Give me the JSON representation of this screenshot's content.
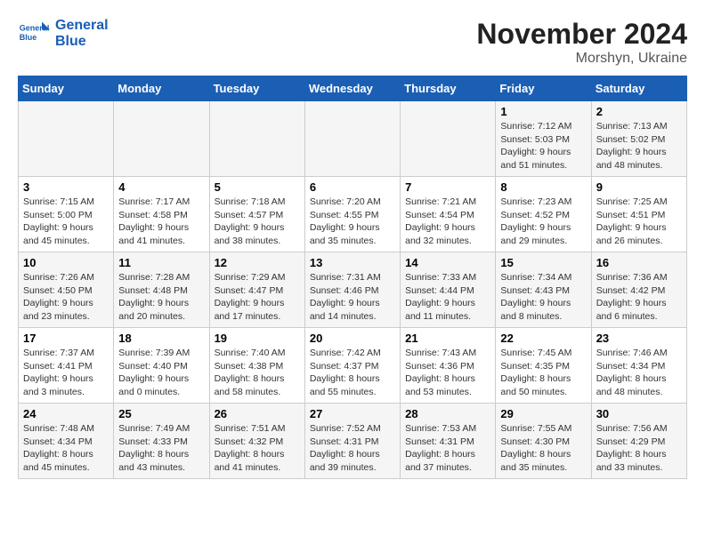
{
  "logo": {
    "line1": "General",
    "line2": "Blue"
  },
  "title": "November 2024",
  "location": "Morshyn, Ukraine",
  "days_of_week": [
    "Sunday",
    "Monday",
    "Tuesday",
    "Wednesday",
    "Thursday",
    "Friday",
    "Saturday"
  ],
  "weeks": [
    [
      {
        "day": "",
        "info": ""
      },
      {
        "day": "",
        "info": ""
      },
      {
        "day": "",
        "info": ""
      },
      {
        "day": "",
        "info": ""
      },
      {
        "day": "",
        "info": ""
      },
      {
        "day": "1",
        "info": "Sunrise: 7:12 AM\nSunset: 5:03 PM\nDaylight: 9 hours and 51 minutes."
      },
      {
        "day": "2",
        "info": "Sunrise: 7:13 AM\nSunset: 5:02 PM\nDaylight: 9 hours and 48 minutes."
      }
    ],
    [
      {
        "day": "3",
        "info": "Sunrise: 7:15 AM\nSunset: 5:00 PM\nDaylight: 9 hours and 45 minutes."
      },
      {
        "day": "4",
        "info": "Sunrise: 7:17 AM\nSunset: 4:58 PM\nDaylight: 9 hours and 41 minutes."
      },
      {
        "day": "5",
        "info": "Sunrise: 7:18 AM\nSunset: 4:57 PM\nDaylight: 9 hours and 38 minutes."
      },
      {
        "day": "6",
        "info": "Sunrise: 7:20 AM\nSunset: 4:55 PM\nDaylight: 9 hours and 35 minutes."
      },
      {
        "day": "7",
        "info": "Sunrise: 7:21 AM\nSunset: 4:54 PM\nDaylight: 9 hours and 32 minutes."
      },
      {
        "day": "8",
        "info": "Sunrise: 7:23 AM\nSunset: 4:52 PM\nDaylight: 9 hours and 29 minutes."
      },
      {
        "day": "9",
        "info": "Sunrise: 7:25 AM\nSunset: 4:51 PM\nDaylight: 9 hours and 26 minutes."
      }
    ],
    [
      {
        "day": "10",
        "info": "Sunrise: 7:26 AM\nSunset: 4:50 PM\nDaylight: 9 hours and 23 minutes."
      },
      {
        "day": "11",
        "info": "Sunrise: 7:28 AM\nSunset: 4:48 PM\nDaylight: 9 hours and 20 minutes."
      },
      {
        "day": "12",
        "info": "Sunrise: 7:29 AM\nSunset: 4:47 PM\nDaylight: 9 hours and 17 minutes."
      },
      {
        "day": "13",
        "info": "Sunrise: 7:31 AM\nSunset: 4:46 PM\nDaylight: 9 hours and 14 minutes."
      },
      {
        "day": "14",
        "info": "Sunrise: 7:33 AM\nSunset: 4:44 PM\nDaylight: 9 hours and 11 minutes."
      },
      {
        "day": "15",
        "info": "Sunrise: 7:34 AM\nSunset: 4:43 PM\nDaylight: 9 hours and 8 minutes."
      },
      {
        "day": "16",
        "info": "Sunrise: 7:36 AM\nSunset: 4:42 PM\nDaylight: 9 hours and 6 minutes."
      }
    ],
    [
      {
        "day": "17",
        "info": "Sunrise: 7:37 AM\nSunset: 4:41 PM\nDaylight: 9 hours and 3 minutes."
      },
      {
        "day": "18",
        "info": "Sunrise: 7:39 AM\nSunset: 4:40 PM\nDaylight: 9 hours and 0 minutes."
      },
      {
        "day": "19",
        "info": "Sunrise: 7:40 AM\nSunset: 4:38 PM\nDaylight: 8 hours and 58 minutes."
      },
      {
        "day": "20",
        "info": "Sunrise: 7:42 AM\nSunset: 4:37 PM\nDaylight: 8 hours and 55 minutes."
      },
      {
        "day": "21",
        "info": "Sunrise: 7:43 AM\nSunset: 4:36 PM\nDaylight: 8 hours and 53 minutes."
      },
      {
        "day": "22",
        "info": "Sunrise: 7:45 AM\nSunset: 4:35 PM\nDaylight: 8 hours and 50 minutes."
      },
      {
        "day": "23",
        "info": "Sunrise: 7:46 AM\nSunset: 4:34 PM\nDaylight: 8 hours and 48 minutes."
      }
    ],
    [
      {
        "day": "24",
        "info": "Sunrise: 7:48 AM\nSunset: 4:34 PM\nDaylight: 8 hours and 45 minutes."
      },
      {
        "day": "25",
        "info": "Sunrise: 7:49 AM\nSunset: 4:33 PM\nDaylight: 8 hours and 43 minutes."
      },
      {
        "day": "26",
        "info": "Sunrise: 7:51 AM\nSunset: 4:32 PM\nDaylight: 8 hours and 41 minutes."
      },
      {
        "day": "27",
        "info": "Sunrise: 7:52 AM\nSunset: 4:31 PM\nDaylight: 8 hours and 39 minutes."
      },
      {
        "day": "28",
        "info": "Sunrise: 7:53 AM\nSunset: 4:31 PM\nDaylight: 8 hours and 37 minutes."
      },
      {
        "day": "29",
        "info": "Sunrise: 7:55 AM\nSunset: 4:30 PM\nDaylight: 8 hours and 35 minutes."
      },
      {
        "day": "30",
        "info": "Sunrise: 7:56 AM\nSunset: 4:29 PM\nDaylight: 8 hours and 33 minutes."
      }
    ]
  ]
}
